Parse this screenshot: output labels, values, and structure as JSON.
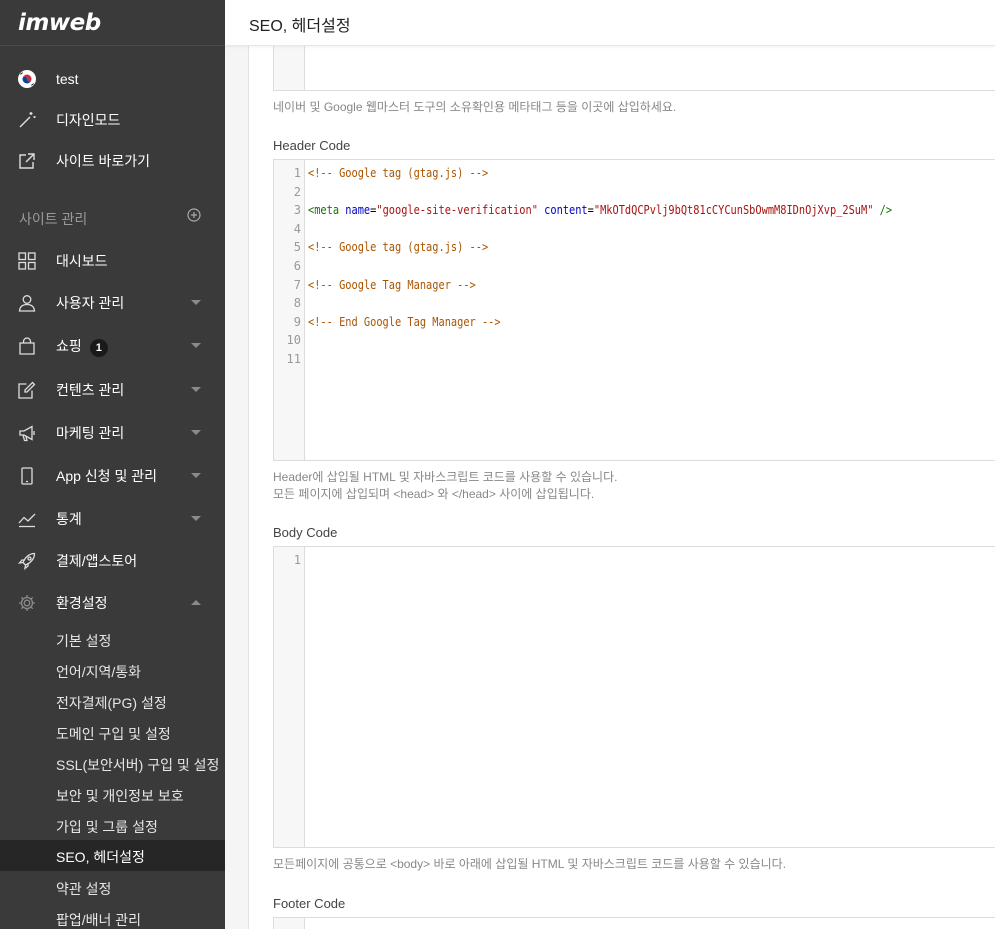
{
  "sidebar": {
    "logo": "imweb",
    "site_name": "test",
    "design_mode": "디자인모드",
    "site_shortcut": "사이트 바로가기",
    "section_label": "사이트 관리",
    "items": [
      {
        "label": "대시보드"
      },
      {
        "label": "사용자 관리"
      },
      {
        "label": "쇼핑",
        "badge": "1"
      },
      {
        "label": "컨텐츠 관리"
      },
      {
        "label": "마케팅 관리"
      },
      {
        "label": "App 신청 및 관리"
      },
      {
        "label": "통계"
      },
      {
        "label": "결제/앱스토어"
      },
      {
        "label": "환경설정"
      }
    ],
    "sub_items": [
      "기본 설정",
      "언어/지역/통화",
      "전자결제(PG) 설정",
      "도메인 구입 및 설정",
      "SSL(보안서버) 구입 및 설정",
      "보안 및 개인정보 보호",
      "가입 및 그룹 설정",
      "SEO, 헤더설정",
      "약관 설정",
      "팝업/배너 관리"
    ]
  },
  "header": {
    "title": "SEO, 헤더설정"
  },
  "main": {
    "meta_help": "네이버 및 Google 웹마스터 도구의 소유확인용 메타태그 등을 이곳에 삽입하세요.",
    "header_code": {
      "label": "Header Code",
      "line_numbers": [
        "1",
        "2",
        "3",
        "4",
        "5",
        "6",
        "7",
        "8",
        "9",
        "10",
        "11"
      ],
      "lines": {
        "l1": "<!-- Google tag (gtag.js) -->",
        "l3_open": "<meta",
        "l3_attr1": "name",
        "l3_val1": "\"google-site-verification\"",
        "l3_attr2": "content",
        "l3_val2": "\"MkOTdQCPvlj9bQt81cCYCunSbOwmM8IDnOjXvp_2SuM\"",
        "l3_close": "/>",
        "l5": "<!-- Google tag (gtag.js) -->",
        "l7": "<!-- Google Tag Manager -->",
        "l9": "<!-- End Google Tag Manager -->"
      },
      "help_line1": "Header에 삽입될 HTML 및 자바스크립트 코드를 사용할 수 있습니다.",
      "help_line2": "모든 페이지에 삽입되며 <head> 와 </head> 사이에 삽입됩니다."
    },
    "body_code": {
      "label": "Body Code",
      "line_numbers": [
        "1"
      ],
      "help": "모든페이지에 공통으로 <body> 바로 아래에 삽입될 HTML 및 자바스크립트 코드를 사용할 수 있습니다."
    },
    "footer_code": {
      "label": "Footer Code"
    }
  }
}
